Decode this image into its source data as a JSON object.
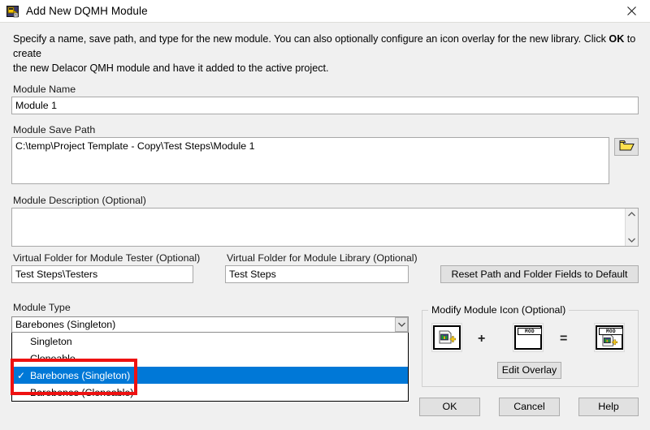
{
  "window": {
    "title": "Add New DQMH Module",
    "icon": "dqmh-module-icon",
    "close_label": "×"
  },
  "instructions": {
    "line1_part1": "Specify a name, save path, and type for the new module. You can also optionally configure an icon overlay for the new library. Click ",
    "line1_bold": "OK",
    "line1_part2": " to create",
    "line2": "the new Delacor QMH module and have it added to the active project."
  },
  "fields": {
    "module_name": {
      "label": "Module Name",
      "value": "Module 1",
      "placeholder": ""
    },
    "module_save_path": {
      "label": "Module Save Path",
      "value": "C:\\temp\\Project Template - Copy\\Test Steps\\Module 1",
      "placeholder": "",
      "browse_icon": "folder-open-icon"
    },
    "module_description": {
      "label": "Module Description (Optional)",
      "value": "",
      "placeholder": "",
      "scroll_up": "⌃",
      "scroll_down": "⌄"
    },
    "virtual_folder_tester": {
      "label": "Virtual Folder for Module Tester (Optional)",
      "value": "Test Steps\\Testers",
      "placeholder": ""
    },
    "virtual_folder_library": {
      "label": "Virtual Folder for Module Library (Optional)",
      "value": "Test Steps",
      "placeholder": ""
    },
    "module_type": {
      "label": "Module Type",
      "value": "Barebones (Singleton)",
      "arrow": "chevron-down-icon",
      "options": [
        {
          "label": "Singleton",
          "checked": false,
          "selected": false
        },
        {
          "label": "Cloneable",
          "checked": false,
          "selected": false
        },
        {
          "label": "Barebones (Singleton)",
          "checked": true,
          "selected": true
        },
        {
          "label": "Barebones (Cloneable)",
          "checked": false,
          "selected": false
        }
      ],
      "check_glyph": "✓"
    }
  },
  "buttons": {
    "reset": "Reset Path and Folder Fields to Default",
    "edit_overlay": "Edit Overlay",
    "ok": "OK",
    "cancel": "Cancel",
    "help": "Help"
  },
  "icon_group": {
    "title": "Modify Module Icon (Optional)",
    "plus": "+",
    "equals": "=",
    "base_icon_name": "vi-document-icon",
    "overlay_band_text": "MOD",
    "result_band_text": "MOD"
  },
  "colors": {
    "dialog_background": "#f0f0f0",
    "titlebar_background": "#ffffff",
    "selection_blue": "#0078d7",
    "highlight_red": "#ee1111",
    "button_face": "#e1e1e1",
    "field_border": "#a8a8a8",
    "text": "#000000"
  }
}
